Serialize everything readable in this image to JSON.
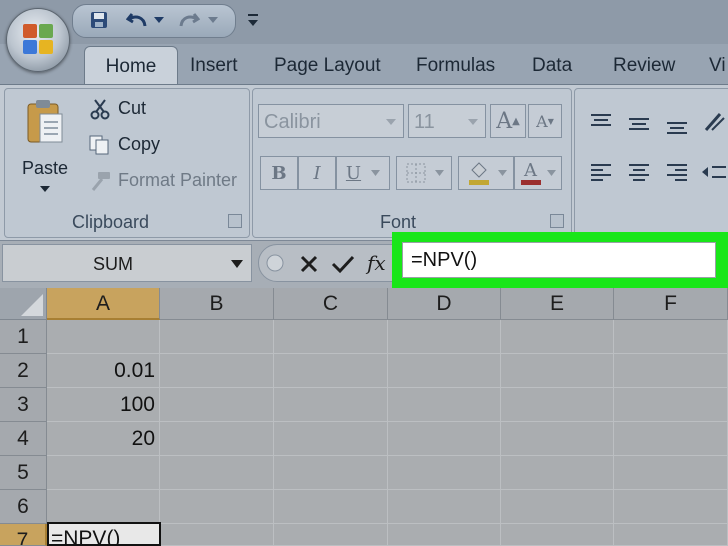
{
  "quick_access": {
    "icons": [
      "save-icon",
      "undo-icon",
      "redo-icon",
      "customize-qat-icon"
    ]
  },
  "tabs": [
    "Home",
    "Insert",
    "Page Layout",
    "Formulas",
    "Data",
    "Review",
    "Vi"
  ],
  "clipboard": {
    "paste_label": "Paste",
    "cut_label": "Cut",
    "copy_label": "Copy",
    "format_painter_label": "Format Painter",
    "group_label": "Clipboard"
  },
  "font": {
    "name": "Calibri",
    "size": "11",
    "group_label": "Font",
    "bold": "B",
    "italic": "I",
    "underline": "U",
    "grow": "A",
    "shrink": "A",
    "color_a": "A"
  },
  "formula_bar": {
    "name_box": "SUM",
    "fx": "fx",
    "formula": "=NPV()"
  },
  "columns": [
    "A",
    "B",
    "C",
    "D",
    "E",
    "F"
  ],
  "rows": [
    {
      "num": "1",
      "a": ""
    },
    {
      "num": "2",
      "a": "0.01"
    },
    {
      "num": "3",
      "a": "100"
    },
    {
      "num": "4",
      "a": "20"
    },
    {
      "num": "5",
      "a": ""
    },
    {
      "num": "6",
      "a": ""
    },
    {
      "num": "7",
      "a": "=NPV()"
    }
  ],
  "colors": {
    "highlight": "#19e619",
    "selected_header": "#c8a35e"
  }
}
